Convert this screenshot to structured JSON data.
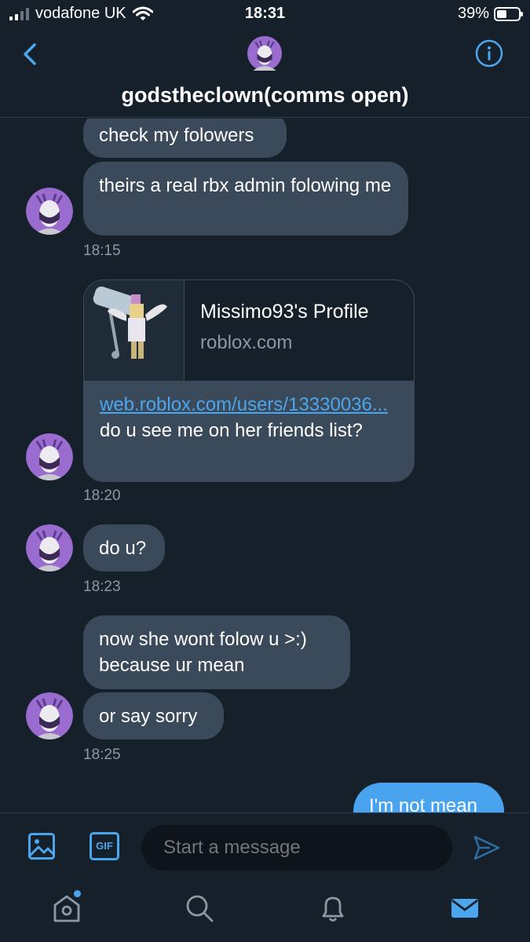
{
  "status_bar": {
    "carrier": "vodafone UK",
    "time": "18:31",
    "battery": "39%"
  },
  "header": {
    "title": "godstheclown(comms open)"
  },
  "messages": {
    "m1": "check my folowers",
    "m2": "theirs a real rbx admin folowing me",
    "t1": "18:15",
    "card_title": "Missimo93's Profile",
    "card_domain": "roblox.com",
    "card_link": "web.roblox.com/users/13330036...",
    "card_text": " do u see me on her friends list?",
    "t2": "18:20",
    "m3": "do u?",
    "t3": "18:23",
    "m4": "now she wont folow u >:) because ur mean",
    "m5": "or say sorry",
    "t4": "18:25",
    "out1": "I'm not mean"
  },
  "composer": {
    "placeholder": "Start a message"
  },
  "tabbar": {
    "icons": [
      "home-icon",
      "search-icon",
      "notifications-icon",
      "messages-icon"
    ]
  },
  "colors": {
    "accent": "#4ba6ee",
    "background": "#16202b",
    "bubble": "#3b4a5a",
    "outgoing": "#4aa3ef"
  }
}
